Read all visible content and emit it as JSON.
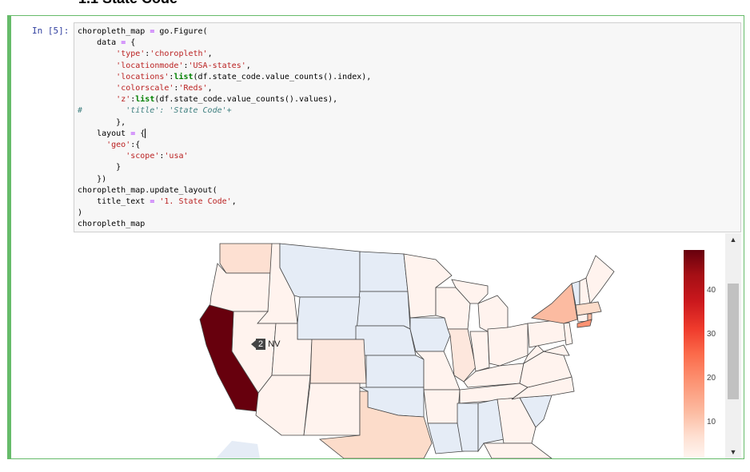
{
  "section_heading": "1.1 State Code",
  "cell": {
    "prompt": "In  [5]:"
  },
  "hover": {
    "value": "2",
    "state": "NV"
  },
  "colorbar": {
    "ticks": [
      "40",
      "30",
      "20",
      "10"
    ]
  },
  "colors": {
    "cell_border": "#66bb6a",
    "no_data_state": "#e5ecf6",
    "max_value": "#67000d"
  },
  "icons": {
    "scroll_up": "▲",
    "scroll_down": "▼"
  }
}
